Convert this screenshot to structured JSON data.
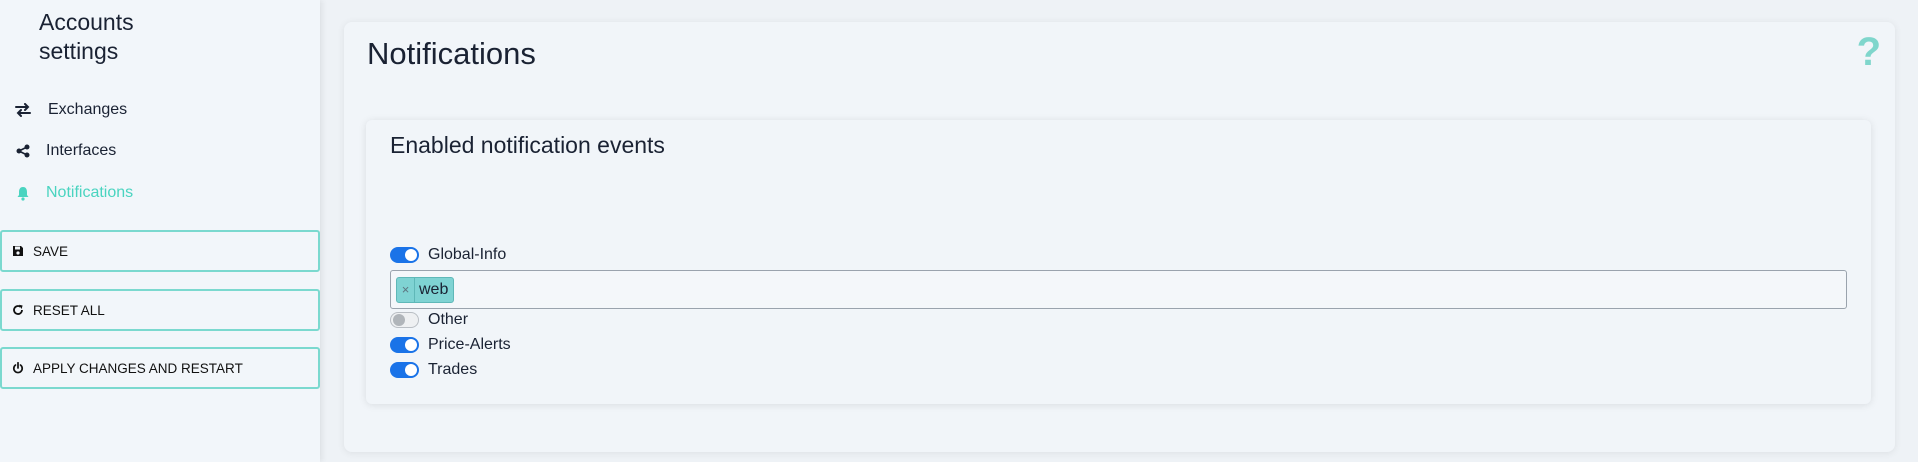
{
  "sidebar": {
    "title": "Accounts settings",
    "items": [
      {
        "label": "Exchanges",
        "icon": "arrows-exchange-icon",
        "active": false
      },
      {
        "label": "Interfaces",
        "icon": "share-nodes-icon",
        "active": false
      },
      {
        "label": "Notifications",
        "icon": "bell-icon",
        "active": true
      }
    ],
    "buttons": {
      "save": "SAVE",
      "reset": "RESET ALL",
      "apply": "APPLY CHANGES AND RESTART"
    }
  },
  "main": {
    "title": "Notifications",
    "help_symbol": "?",
    "section_title": "Enabled notification events",
    "events": [
      {
        "label": "Global-Info",
        "enabled": true
      },
      {
        "label": "Other",
        "enabled": false
      },
      {
        "label": "Price-Alerts",
        "enabled": true
      },
      {
        "label": "Trades",
        "enabled": true
      }
    ],
    "global_info_channels": [
      {
        "label": "web",
        "remove_symbol": "×"
      }
    ]
  },
  "colors": {
    "accent": "#4ad4c0",
    "toggle_on": "#1a73e8",
    "tag_bg": "#7fd3d3",
    "button_border": "#7bd9cf"
  }
}
